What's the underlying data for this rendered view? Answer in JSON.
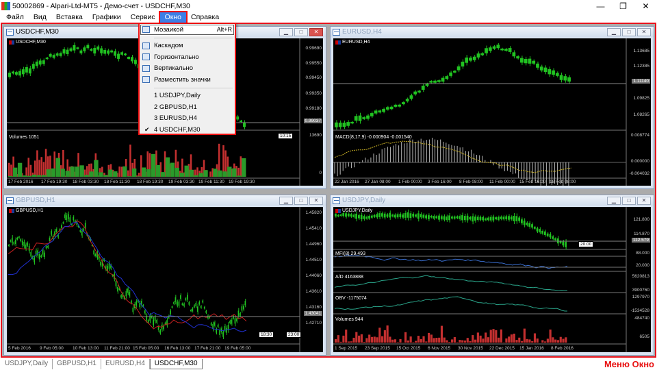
{
  "window": {
    "title": "50002869 - Alpari-Ltd-MT5 - Демо-счет - USDCHF,M30"
  },
  "menu": [
    "Файл",
    "Вид",
    "Вставка",
    "Графики",
    "Сервис",
    "Окно",
    "Справка"
  ],
  "menu_active": "Окно",
  "dropdown": {
    "items": [
      {
        "label": "Мозаикой",
        "shortcut": "Alt+R",
        "icon": "tile-icon"
      },
      {
        "label": "Каскадом",
        "icon": "cascade-icon"
      },
      {
        "label": "Горизонтально",
        "icon": "tile-horizontal-icon"
      },
      {
        "label": "Вертикально",
        "icon": "tile-vertical-icon"
      },
      {
        "label": "Разместить значки",
        "icon": "arrange-icons-icon"
      }
    ],
    "windows": [
      {
        "label": "1 USDJPY,Daily",
        "checked": false
      },
      {
        "label": "2 GBPUSD,H1",
        "checked": false
      },
      {
        "label": "3 EURUSD,H4",
        "checked": false
      },
      {
        "label": "4 USDCHF,M30",
        "checked": true
      }
    ]
  },
  "charts": {
    "usdchf": {
      "title": "USDCHF,M30",
      "symbol": "USDCHF,M30",
      "indicator": "Volumes 1051",
      "prices": [
        "0.99690",
        "0.99550",
        "0.99450",
        "0.99350",
        "0.99180",
        "0.99037"
      ],
      "vol_labels": [
        "13690",
        "0"
      ],
      "time_tag": "10:15",
      "dates": [
        "17 Feb 2016",
        "17 Feb 19:30",
        "18 Feb 03:30",
        "18 Feb 11:30",
        "18 Feb 19:30",
        "19 Feb 03:30",
        "19 Feb 11:30",
        "19 Feb 19:30"
      ]
    },
    "eurusd": {
      "title": "EURUSD,H4",
      "symbol": "EURUSD,H4",
      "indicator": "MACD(8,17,9) -0.000904 -0.001540",
      "prices": [
        "1.13685",
        "1.12385",
        "1.11140",
        "1.09825",
        "1.08265"
      ],
      "ind_labels": [
        "0.008774",
        "0.000000",
        "-0.004032"
      ],
      "dates": [
        "22 Jan 2016",
        "27 Jan 08:00",
        "1 Feb 00:00",
        "3 Feb 16:00",
        "8 Feb 08:00",
        "11 Feb 00:00",
        "15 Feb 16:00",
        "18 Feb 08:00"
      ]
    },
    "gbpusd": {
      "title": "GBPUSD,H1",
      "symbol": "GBPUSD,H1",
      "prices": [
        "1.45820",
        "1.45410",
        "1.44960",
        "1.44510",
        "1.44060",
        "1.43610",
        "1.43160",
        "1.43041",
        "1.42710"
      ],
      "time_tags": [
        "18:30",
        "23:00"
      ],
      "dates": [
        "5 Feb 2016",
        "9 Feb 05:00",
        "10 Feb 13:00",
        "11 Feb 21:00",
        "15 Feb 05:00",
        "16 Feb 13:00",
        "17 Feb 21:00",
        "19 Feb 05:00"
      ]
    },
    "usdjpy": {
      "title": "USDJPY,Daily",
      "symbol": "USDJPY,Daily",
      "prices": [
        "121.800",
        "114.870",
        "112.579"
      ],
      "time_tag": "20:00",
      "indicators": [
        {
          "label": "MFI(8) 29.493",
          "values": [
            "88.000",
            "20.000"
          ]
        },
        {
          "label": "A/D 4163888",
          "values": [
            "5620813",
            "3900760"
          ]
        },
        {
          "label": "OBV -1175074",
          "values": [
            "1297970",
            "-1534528"
          ]
        },
        {
          "label": "Volumes 944",
          "values": [
            "484740",
            "6505"
          ]
        }
      ],
      "dates": [
        "1 Sep 2015",
        "23 Sep 2015",
        "15 Oct 2015",
        "6 Nov 2015",
        "30 Nov 2015",
        "22 Dec 2015",
        "15 Jan 2016",
        "8 Feb 2016"
      ]
    }
  },
  "tabs": [
    "USDJPY,Daily",
    "GBPUSD,H1",
    "EURUSD,H4",
    "USDCHF,M30"
  ],
  "active_tab": "USDCHF,M30",
  "annotation": "Меню Окно"
}
